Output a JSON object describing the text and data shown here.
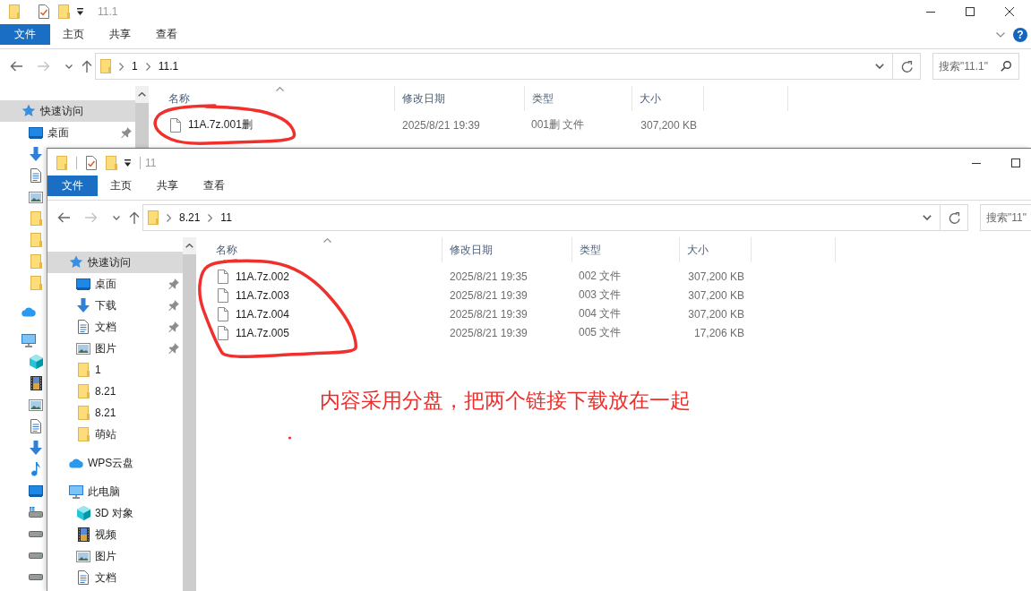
{
  "windows": [
    {
      "title": "11.1",
      "ribbon_tabs": [
        {
          "label": "文件",
          "kind": "file_menu"
        },
        {
          "label": "主页",
          "kind": "tab"
        },
        {
          "label": "共享",
          "kind": "tab"
        },
        {
          "label": "查看",
          "kind": "tab"
        }
      ],
      "help_button": "?",
      "breadcrumb": [
        "1",
        "11.1"
      ],
      "search": {
        "placeholder": "搜索\"11.1\""
      },
      "sidebar": [
        {
          "label": "快速访问",
          "kind": "quick_access",
          "selected": true,
          "children": [
            {
              "label": "桌面",
              "kind": "desktop",
              "selected": false,
              "pinned": true
            },
            {
              "kind": "downloads",
              "selected": false,
              "pinned": false
            },
            {
              "kind": "documents",
              "selected": false,
              "pinned": false
            },
            {
              "kind": "pictures",
              "selected": false,
              "pinned": false
            },
            {
              "kind": "folder",
              "selected": false,
              "pinned": false
            },
            {
              "kind": "folder",
              "selected": false,
              "pinned": false
            },
            {
              "kind": "folder",
              "selected": false,
              "pinned": false
            },
            {
              "kind": "folder",
              "selected": false,
              "pinned": false
            }
          ]
        },
        {
          "kind": "cloud",
          "selected": false
        },
        {
          "kind": "pc",
          "selected": false,
          "children": [
            {
              "kind": "cube",
              "selected": false,
              "pinned": false
            },
            {
              "kind": "videos",
              "selected": false,
              "pinned": false
            },
            {
              "kind": "pictures",
              "selected": false,
              "pinned": false
            },
            {
              "kind": "documents",
              "selected": false,
              "pinned": false
            },
            {
              "kind": "downloads",
              "selected": false,
              "pinned": false
            },
            {
              "kind": "music",
              "selected": false,
              "pinned": false
            },
            {
              "kind": "desktop",
              "selected": false,
              "pinned": false
            },
            {
              "kind": "system_drive",
              "selected": false,
              "pinned": false
            },
            {
              "kind": "drive",
              "selected": false,
              "pinned": false
            },
            {
              "kind": "drive",
              "selected": false,
              "pinned": false
            },
            {
              "kind": "drive",
              "selected": false,
              "pinned": false
            }
          ]
        }
      ],
      "columns": [
        {
          "label": "名称",
          "sorted": true
        },
        {
          "label": "修改日期",
          "sorted": false
        },
        {
          "label": "类型",
          "sorted": false
        },
        {
          "label": "大小",
          "sorted": false
        }
      ],
      "files": [
        {
          "name": "11A.7z.001删",
          "modified": "2025/8/21 19:39",
          "type": "001删 文件",
          "size": "307,200 KB"
        }
      ]
    },
    {
      "title": "11",
      "ribbon_tabs": [
        {
          "label": "文件",
          "kind": "file_menu"
        },
        {
          "label": "主页",
          "kind": "tab"
        },
        {
          "label": "共享",
          "kind": "tab"
        },
        {
          "label": "查看",
          "kind": "tab"
        }
      ],
      "breadcrumb": [
        "8.21",
        "11"
      ],
      "search": {
        "placeholder": "搜索\"11\""
      },
      "sidebar": [
        {
          "label": "快速访问",
          "kind": "quick_access",
          "selected": true,
          "children": [
            {
              "label": "桌面",
              "kind": "desktop",
              "selected": false,
              "pinned": true
            },
            {
              "label": "下载",
              "kind": "downloads",
              "selected": false,
              "pinned": true
            },
            {
              "label": "文档",
              "kind": "documents",
              "selected": false,
              "pinned": true
            },
            {
              "label": "图片",
              "kind": "pictures",
              "selected": false,
              "pinned": true
            },
            {
              "label": "1",
              "kind": "folder",
              "selected": false,
              "pinned": false
            },
            {
              "label": "8.21",
              "kind": "folder",
              "selected": false,
              "pinned": false
            },
            {
              "label": "8.21",
              "kind": "folder",
              "selected": false,
              "pinned": false
            },
            {
              "label": "萌站",
              "kind": "folder",
              "selected": false,
              "pinned": false
            }
          ]
        },
        {
          "label": "WPS云盘",
          "kind": "cloud",
          "selected": false
        },
        {
          "label": "此电脑",
          "kind": "pc",
          "selected": false,
          "children": [
            {
              "label": "3D 对象",
              "kind": "cube",
              "selected": false,
              "pinned": false
            },
            {
              "label": "视频",
              "kind": "videos",
              "selected": false,
              "pinned": false
            },
            {
              "label": "图片",
              "kind": "pictures",
              "selected": false,
              "pinned": false
            },
            {
              "label": "文档",
              "kind": "documents",
              "selected": false,
              "pinned": false
            }
          ]
        }
      ],
      "columns": [
        {
          "label": "名称",
          "sorted": true
        },
        {
          "label": "修改日期",
          "sorted": false
        },
        {
          "label": "类型",
          "sorted": false
        },
        {
          "label": "大小",
          "sorted": false
        }
      ],
      "files": [
        {
          "name": "11A.7z.002",
          "modified": "2025/8/21 19:35",
          "type": "002 文件",
          "size": "307,200 KB"
        },
        {
          "name": "11A.7z.003",
          "modified": "2025/8/21 19:39",
          "type": "003 文件",
          "size": "307,200 KB"
        },
        {
          "name": "11A.7z.004",
          "modified": "2025/8/21 19:39",
          "type": "004 文件",
          "size": "307,200 KB"
        },
        {
          "name": "11A.7z.005",
          "modified": "2025/8/21 19:39",
          "type": "005 文件",
          "size": "17,206 KB"
        }
      ]
    }
  ],
  "annotation": {
    "note": "内容采用分盘，把两个链接下载放在一起"
  }
}
